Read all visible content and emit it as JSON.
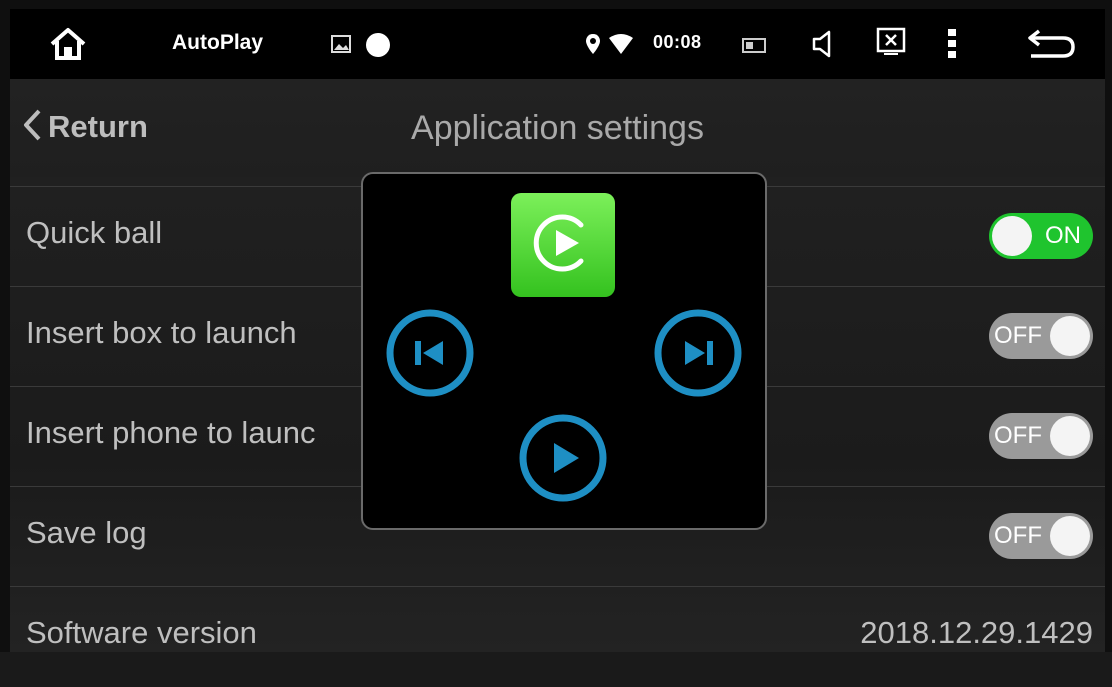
{
  "statusbar": {
    "app_name": "AutoPlay",
    "time": "00:08",
    "icons": [
      "home-icon",
      "gallery-icon",
      "circle-icon",
      "location-icon",
      "wifi-icon",
      "battery-icon",
      "volume-icon",
      "close-box-icon",
      "menu-dots-icon",
      "back-icon"
    ]
  },
  "header": {
    "return_label": "Return",
    "title": "Application settings"
  },
  "settings": [
    {
      "label": "Quick ball",
      "control": "toggle",
      "state": "ON"
    },
    {
      "label": "Insert box to launch",
      "control": "toggle",
      "state": "OFF"
    },
    {
      "label": "Insert phone to launc",
      "control": "toggle",
      "state": "OFF"
    },
    {
      "label": "Save log",
      "control": "toggle",
      "state": "OFF"
    },
    {
      "label": "Software version",
      "control": "value",
      "value": "2018.12.29.1429"
    }
  ],
  "popup": {
    "buttons": [
      "carplay-icon",
      "previous-track-icon",
      "next-track-icon",
      "play-icon"
    ],
    "colors": {
      "accent_blue": "#1e8fc4",
      "carplay_green": "#34c21f"
    }
  },
  "colors": {
    "toggle_on": "#1fc42e",
    "toggle_off": "#9a9a9a"
  }
}
